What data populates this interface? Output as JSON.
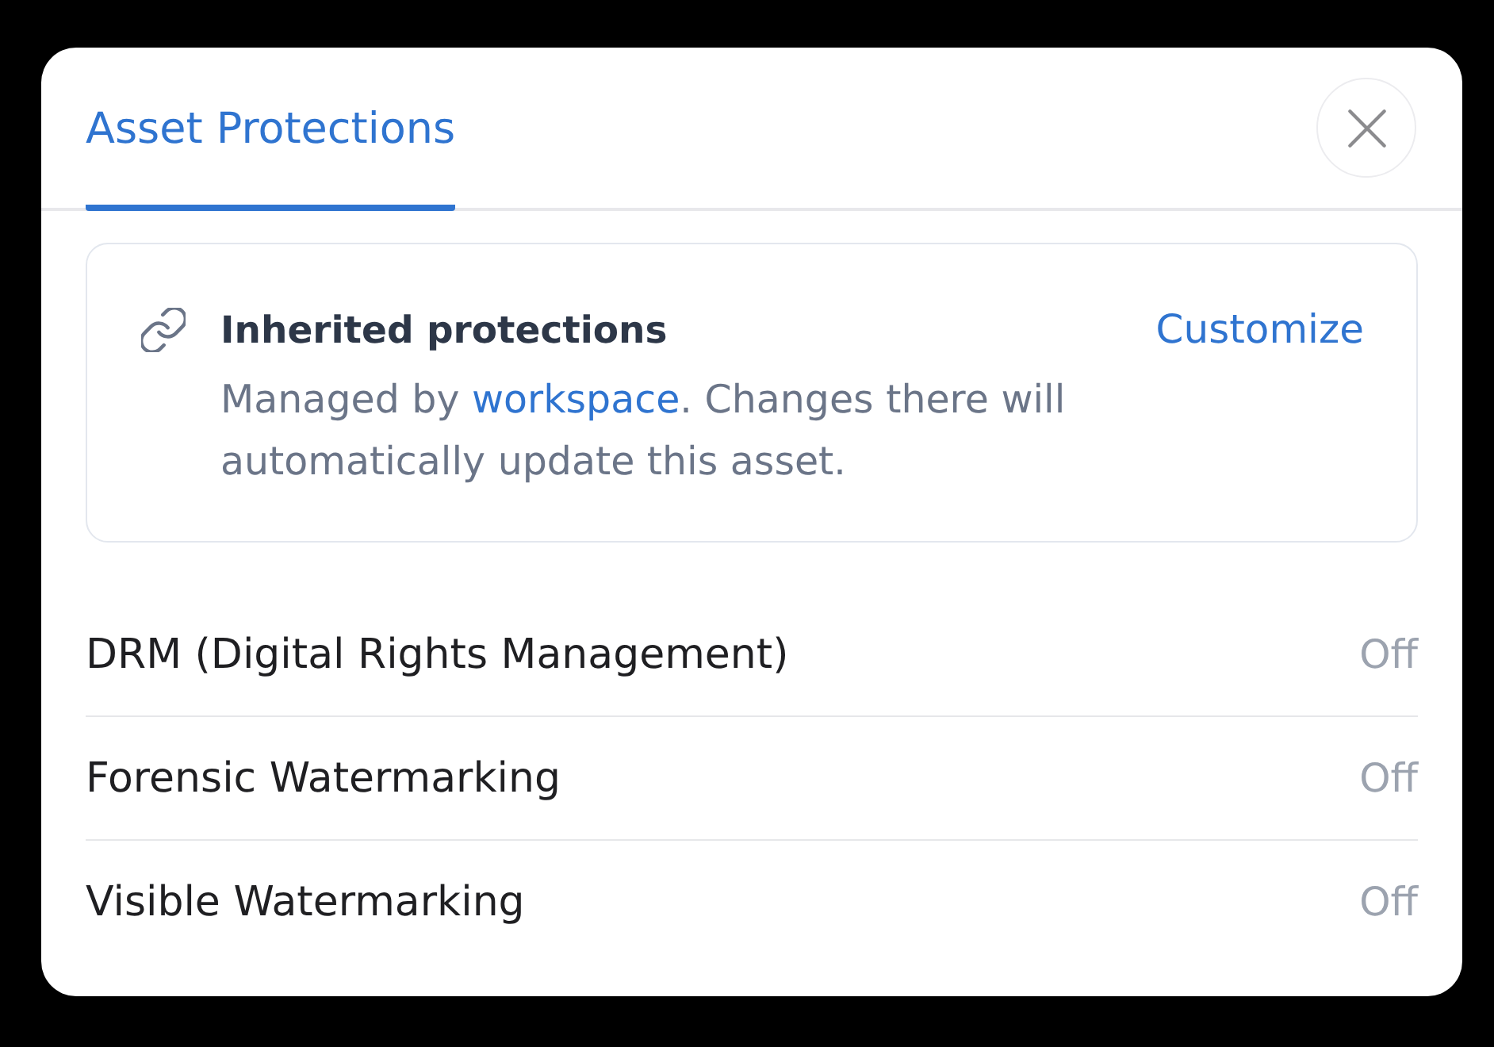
{
  "tabs": [
    {
      "label": "Asset Protections",
      "selected": true
    }
  ],
  "inherited": {
    "title": "Inherited protections",
    "action": "Customize",
    "description_parts": [
      {
        "kind": "text",
        "text": "Managed by "
      },
      {
        "kind": "link",
        "text": "workspace"
      },
      {
        "kind": "text",
        "text": ". Changes there will automatically update this asset."
      }
    ]
  },
  "protections": [
    {
      "name": "DRM (Digital Rights Management)",
      "status": "Off"
    },
    {
      "name": "Forensic Watermarking",
      "status": "Off"
    },
    {
      "name": "Visible Watermarking",
      "status": "Off"
    }
  ]
}
